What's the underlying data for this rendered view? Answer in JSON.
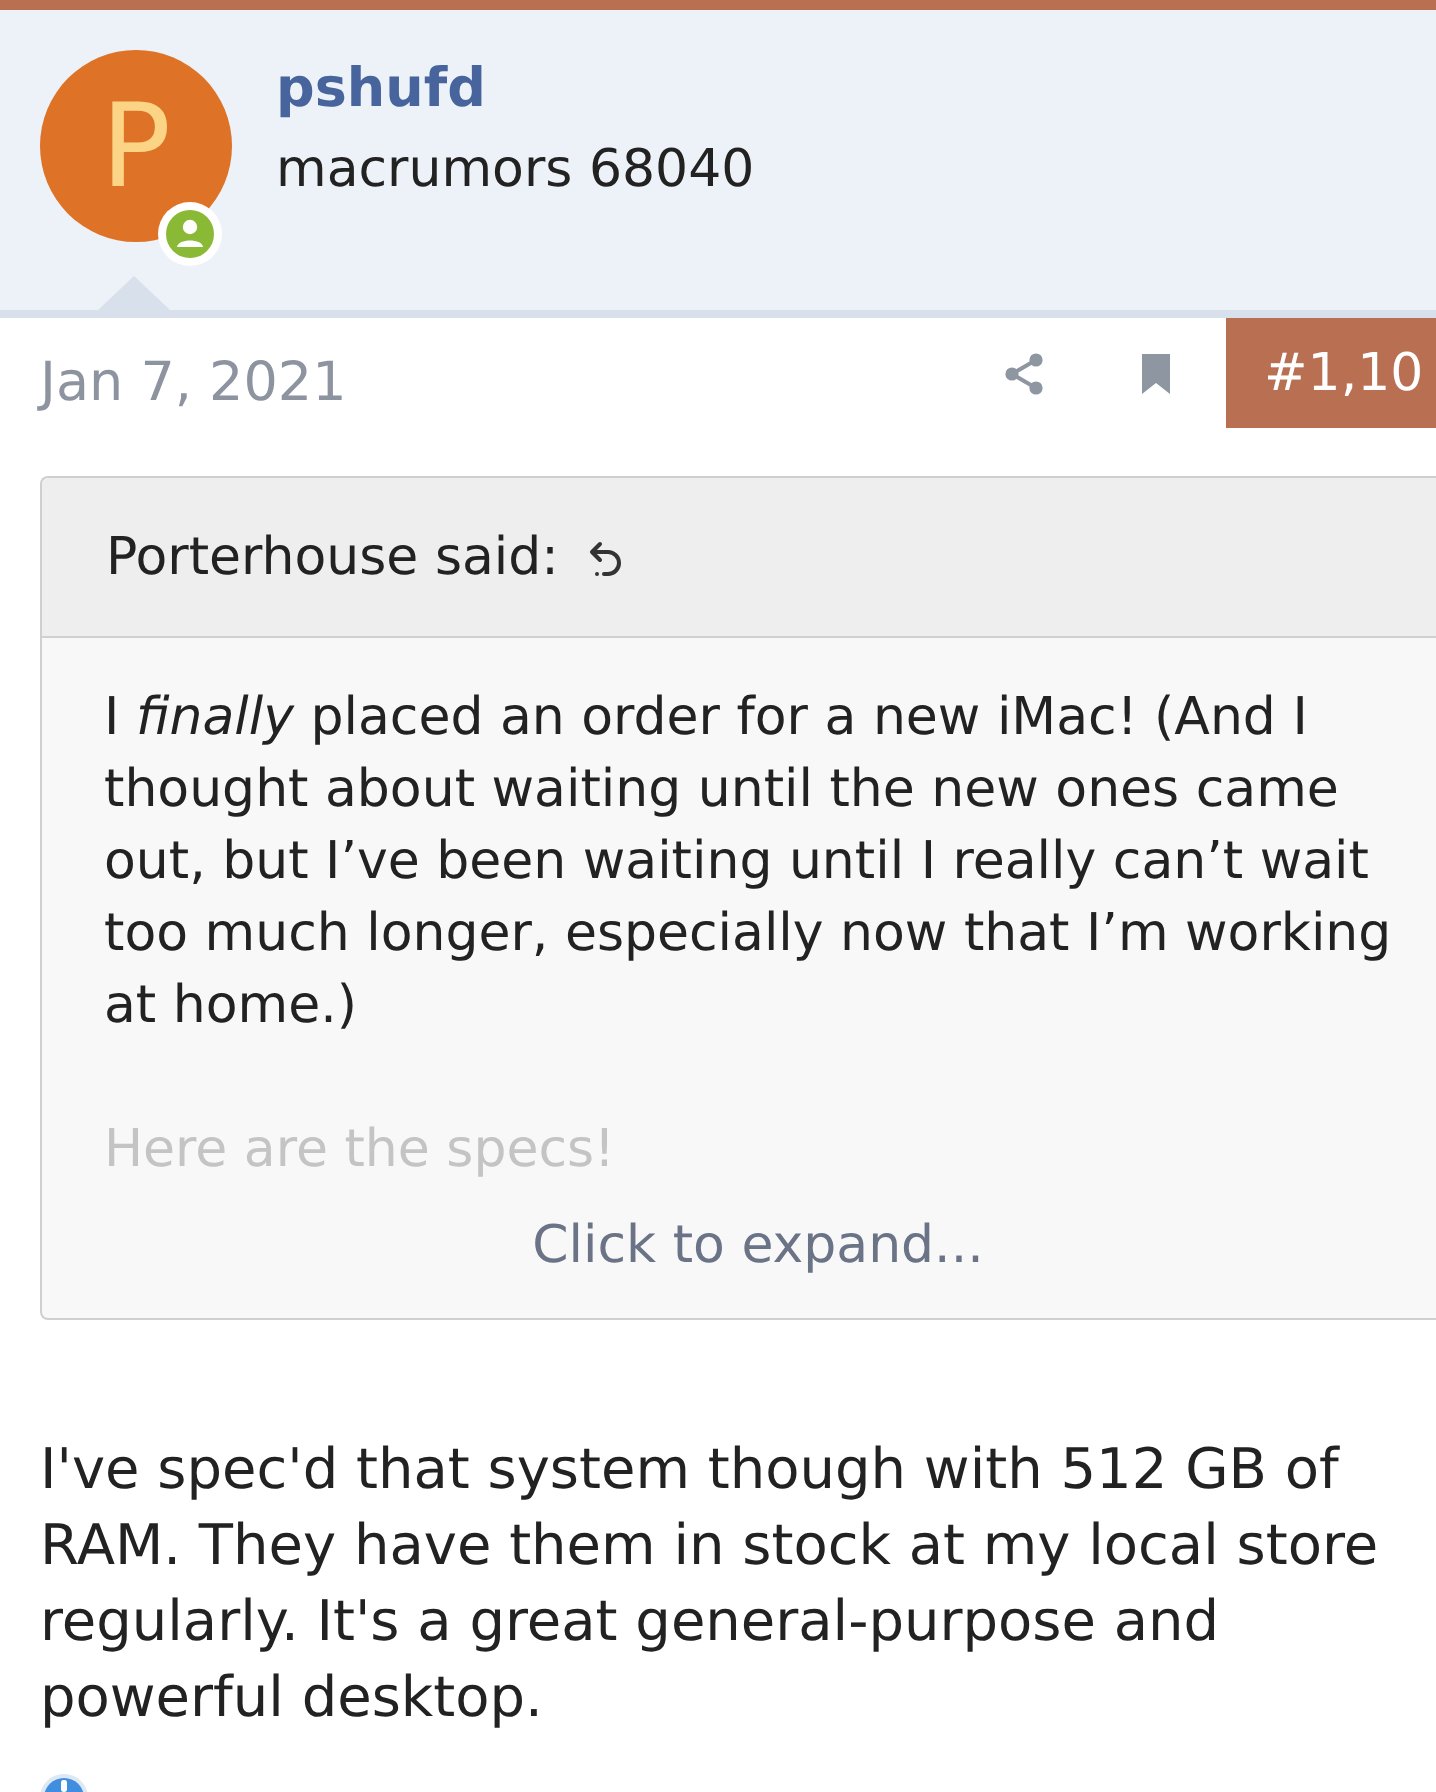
{
  "author": {
    "avatar_letter": "P",
    "name": "pshufd",
    "title": "macrumors 68040",
    "online": true
  },
  "post": {
    "date": "Jan 7, 2021",
    "number": "#1,10"
  },
  "quote": {
    "attribution": "Porterhouse said:",
    "collapsed": true,
    "paragraphs": [
      "I *finally* placed an order for a new iMac! (And I thought about waiting until the new ones came out, but I’ve been waiting until I really can’t wait too much longer, especially now that I’m working at home.)",
      "Here are the specs!"
    ],
    "expand_label": "Click to expand..."
  },
  "message": "I've spec'd that system though with 512 GB of RAM. They have them in stock at my local store regularly. It's a great general-purpose and powerful desktop."
}
